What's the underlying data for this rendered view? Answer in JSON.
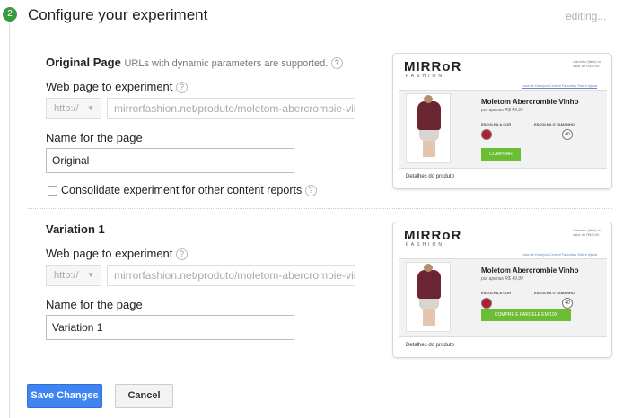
{
  "header": {
    "step_number": "2",
    "title": "Configure your experiment",
    "status": "editing..."
  },
  "original": {
    "title": "Original Page",
    "title_hint": "URLs with dynamic parameters are supported.",
    "url_label": "Web page to experiment",
    "protocol": "http://",
    "url": "mirrorfashion.net/produto/moletom-abercrombie-vinho",
    "name_label": "Name for the page",
    "name_value": "Original",
    "consolidate_label": "Consolidate experiment for other content reports"
  },
  "variation": {
    "title": "Variation 1",
    "url_label": "Web page to experiment",
    "protocol": "http://",
    "url": "mirrorfashion.net/produto/moletom-abercrombie-vinho",
    "name_label": "Name for the page",
    "name_value": "Variation 1"
  },
  "thumb_original": {
    "logo": "MIRRoR",
    "logo_sub": "FASHION",
    "topright": "Carrinho (item) no valor de R$ 0,00",
    "nav": "Lista de Desejos   Central Favoritos   Sobre   Ajuda",
    "product_name": "Moletom Abercrombie Vinho",
    "price": "por apenas R$ 49,99",
    "color_label": "ESCOLHA A COR",
    "size_label": "ESCOLHA O TAMANHO",
    "size_value": "40",
    "buy_label": "COMPRAR",
    "details": "Detalhes do produto"
  },
  "thumb_variation": {
    "logo": "MIRRoR",
    "logo_sub": "FASHION",
    "topright": "Carrinho (item) no valor de R$ 0,00",
    "nav": "Lista de Desejos   Central Favoritos   Sobre   Ajuda",
    "product_name": "Moletom Abercrombie Vinho",
    "price": "por apenas R$ 49,99",
    "color_label": "ESCOLHA A COR",
    "size_label": "ESCOLHA O TAMANHO",
    "size_value": "40",
    "buy_label": "COMPRE E PARCELE EM 10X",
    "details": "Detalhes do produto"
  },
  "actions": {
    "save_label": "Save Changes",
    "cancel_label": "Cancel"
  },
  "colors": {
    "primary_button": "#3f84f0",
    "step_badge": "#3a9a3f",
    "buy_button": "#6cbd35",
    "product_color": "#b31d33"
  },
  "icons": {
    "help": "question-mark-icon",
    "dropdown": "chevron-down-icon"
  }
}
